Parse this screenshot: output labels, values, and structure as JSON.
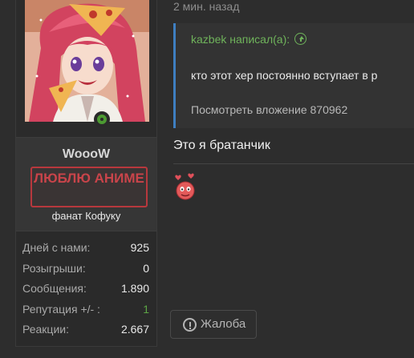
{
  "post": {
    "time": "2 мин. назад",
    "quote": {
      "author_line": "kazbek написал(а):",
      "text": "кто этот хер постоянно вступает в р",
      "attachment": "Посмотреть вложение 870962"
    },
    "message": "Это я братанчик",
    "report_label": "Жалоба"
  },
  "user": {
    "username": "WoooW",
    "banner": "ЛЮБЛЮ АНИМЕ",
    "title": "фанат Кофуку",
    "stats": [
      {
        "label": "Дней с нами:",
        "value": "925"
      },
      {
        "label": "Розыгрыши:",
        "value": "0"
      },
      {
        "label": "Сообщения:",
        "value": "1.890"
      },
      {
        "label": "Репутация +/- :",
        "value": "1"
      },
      {
        "label": "Реакции:",
        "value": "2.667"
      }
    ]
  },
  "colors": {
    "accent_green": "#6fb35b",
    "quote_border": "#3e7fc1",
    "banner_red": "#c9444a",
    "online": "#4c9a32"
  }
}
